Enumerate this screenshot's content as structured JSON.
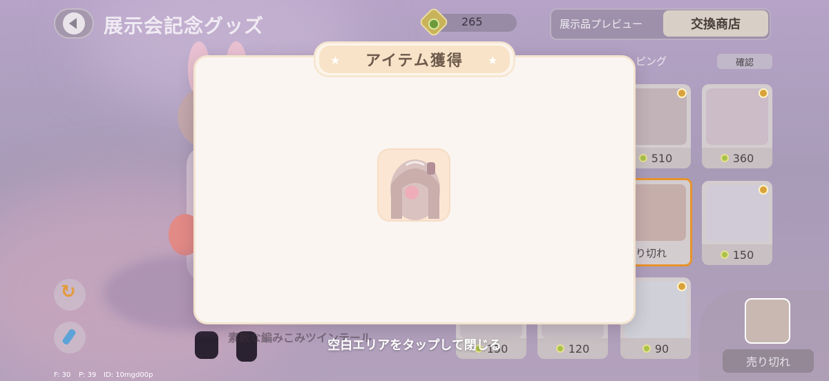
{
  "header": {
    "back_label": "",
    "title": "展示会記念グッズ",
    "coins": "265",
    "tab_preview": "展示品プレビュー",
    "tab_shop": "交換商店"
  },
  "toolbar": {
    "sort_label": "ピング",
    "confirm_label": "確認"
  },
  "grid": {
    "cards": [
      {
        "price": "510",
        "sold_out": false,
        "selected": false
      },
      {
        "price": "360",
        "sold_out": false,
        "selected": false
      },
      {
        "price": "",
        "sold_out": true,
        "selected": true,
        "label": "売り切れ"
      },
      {
        "price": "150",
        "sold_out": false,
        "selected": false
      },
      {
        "price": "150",
        "sold_out": false,
        "selected": false
      },
      {
        "price": "120",
        "sold_out": false,
        "selected": false
      },
      {
        "price": "90",
        "sold_out": false,
        "selected": false
      }
    ]
  },
  "preview": {
    "sold_out_label": "売り切れ"
  },
  "item_name": "素敵な編みこみツインテール",
  "dialog": {
    "title": "アイテム獲得",
    "star_left": "★",
    "star_right": "★",
    "close_hint": "空白エリアをタップして閉じる"
  },
  "debug": {
    "fps": "F: 30",
    "ping": "P: 39",
    "id": "ID: 10mgd00p"
  },
  "colors": {
    "accent": "#e8932a",
    "dialog_bg": "#faf5f1",
    "dialog_header": "#f8e3c8"
  }
}
